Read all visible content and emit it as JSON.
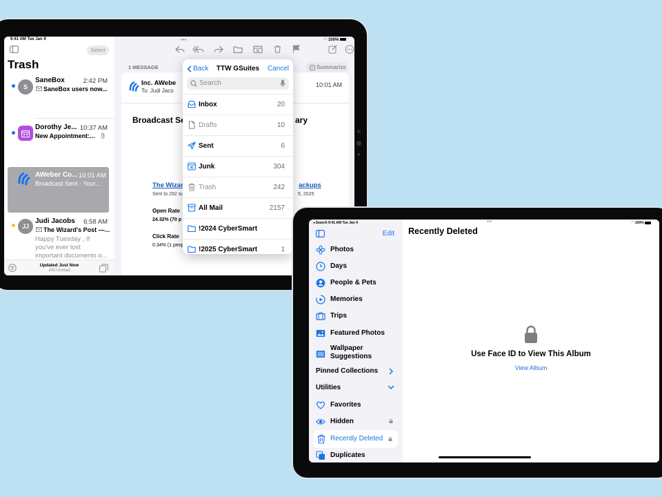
{
  "mail": {
    "status": {
      "time": "9:41 AM  Tue Jan 9",
      "battery": "100%"
    },
    "sidebar": {
      "title": "Trash",
      "select_label": "Select",
      "messages": [
        {
          "from": "SaneBox",
          "time": "2:42 PM",
          "subject": "SaneBox users now...",
          "avatar": "S"
        },
        {
          "from": "Dorothy Je...",
          "time": "10:37 AM",
          "subject": "New Appointment:..."
        },
        {
          "from": "AWeber Co...",
          "time": "10:01 AM",
          "subject": "Broadcast Sent - Your..."
        },
        {
          "from": "Judi Jacobs",
          "time": "6:58 AM",
          "subject": "The Wizard's Post —...",
          "preview": [
            "Happy Tuesday , If",
            "you've ever lost",
            "important documents o..."
          ],
          "avatar": "JJ"
        }
      ],
      "footer_title": "Updated Just Now",
      "footer_sub": "242 Unread"
    },
    "main": {
      "count_label": "1 MESSAGE",
      "summarize_label": "Summarize",
      "sender": "Inc. AWebe",
      "to": "To: Judi Jaco",
      "time": "10:01 AM",
      "subject_left": "Broadcast Se",
      "subject_right": "ary",
      "link_left": "The Wizard",
      "link_right": "ackups",
      "sent_to": "Sent to 292 su",
      "sent_right": "5, 2025",
      "open_rate_label": "Open Rate",
      "open_rate_value": "24.32% (70 p",
      "click_rate_label": "Click Rate",
      "click_rate_value": "0.34% (1 peop"
    },
    "popover": {
      "back_label": "Back",
      "title": "TTW GSuites",
      "cancel_label": "Cancel",
      "search_placeholder": "Search",
      "folders": [
        {
          "name": "Inbox",
          "count": "20",
          "icon": "tray-icon"
        },
        {
          "name": "Drafts",
          "count": "10",
          "icon": "document-icon"
        },
        {
          "name": "Sent",
          "count": "6",
          "icon": "paperplane-icon"
        },
        {
          "name": "Junk",
          "count": "304",
          "icon": "junk-icon"
        },
        {
          "name": "Trash",
          "count": "242",
          "icon": "trash-icon"
        },
        {
          "name": "All Mail",
          "count": "2157",
          "icon": "archive-icon"
        },
        {
          "name": "!2024 CyberSmart",
          "count": "",
          "icon": "folder-icon"
        },
        {
          "name": "!2025 CyberSmart",
          "count": "1",
          "icon": "folder-icon"
        }
      ]
    }
  },
  "photos": {
    "status": {
      "left": "◂ Search  9:41 AM  Tue Jan 9",
      "battery": "100%"
    },
    "edit_label": "Edit",
    "title": "Recently Deleted",
    "sidebar": [
      {
        "label": "Photos",
        "icon": "photos-icon"
      },
      {
        "label": "Days",
        "icon": "clock-icon"
      },
      {
        "label": "People & Pets",
        "icon": "person-icon"
      },
      {
        "label": "Memories",
        "icon": "memories-icon"
      },
      {
        "label": "Trips",
        "icon": "suitcase-icon"
      },
      {
        "label": "Featured Photos",
        "icon": "image-icon"
      },
      {
        "label": "Wallpaper",
        "label2": "Suggestions",
        "icon": "wallpaper-icon"
      }
    ],
    "pinned_label": "Pinned Collections",
    "utilities_label": "Utilities",
    "utilities": [
      {
        "label": "Favorites",
        "icon": "heart-icon"
      },
      {
        "label": "Hidden",
        "icon": "eye-icon",
        "locked": true
      },
      {
        "label": "Recently Deleted",
        "icon": "trash-icon",
        "locked": true,
        "selected": true
      },
      {
        "label": "Duplicates",
        "icon": "duplicate-icon"
      }
    ],
    "locked_message": "Use Face ID to View This Album",
    "view_album_label": "View Album"
  },
  "colors": {
    "background": "#bde0f2",
    "accent": "#1a73e8",
    "selected_row": "#a9a9ad"
  }
}
